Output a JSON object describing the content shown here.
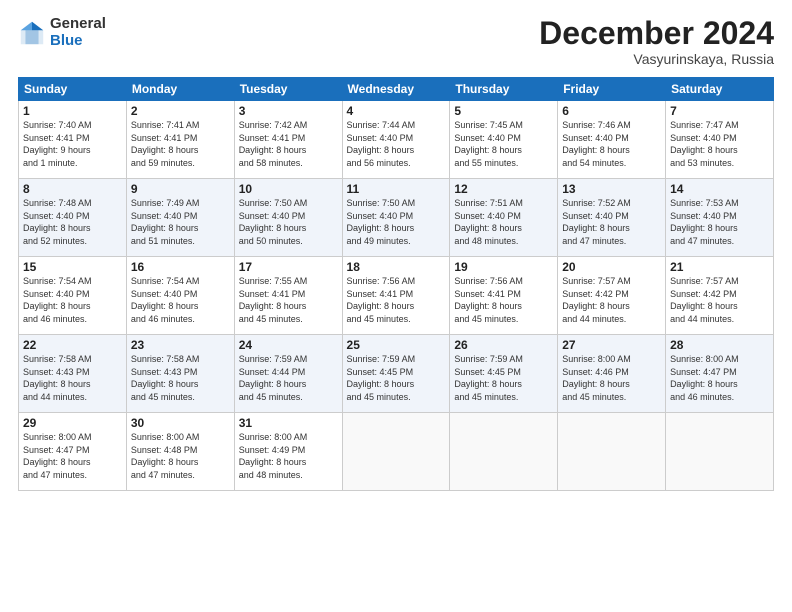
{
  "logo": {
    "general": "General",
    "blue": "Blue"
  },
  "header": {
    "month_title": "December 2024",
    "location": "Vasyurinskaya, Russia"
  },
  "weekdays": [
    "Sunday",
    "Monday",
    "Tuesday",
    "Wednesday",
    "Thursday",
    "Friday",
    "Saturday"
  ],
  "weeks": [
    [
      {
        "day": "1",
        "info": "Sunrise: 7:40 AM\nSunset: 4:41 PM\nDaylight: 9 hours\nand 1 minute."
      },
      {
        "day": "2",
        "info": "Sunrise: 7:41 AM\nSunset: 4:41 PM\nDaylight: 8 hours\nand 59 minutes."
      },
      {
        "day": "3",
        "info": "Sunrise: 7:42 AM\nSunset: 4:41 PM\nDaylight: 8 hours\nand 58 minutes."
      },
      {
        "day": "4",
        "info": "Sunrise: 7:44 AM\nSunset: 4:40 PM\nDaylight: 8 hours\nand 56 minutes."
      },
      {
        "day": "5",
        "info": "Sunrise: 7:45 AM\nSunset: 4:40 PM\nDaylight: 8 hours\nand 55 minutes."
      },
      {
        "day": "6",
        "info": "Sunrise: 7:46 AM\nSunset: 4:40 PM\nDaylight: 8 hours\nand 54 minutes."
      },
      {
        "day": "7",
        "info": "Sunrise: 7:47 AM\nSunset: 4:40 PM\nDaylight: 8 hours\nand 53 minutes."
      }
    ],
    [
      {
        "day": "8",
        "info": "Sunrise: 7:48 AM\nSunset: 4:40 PM\nDaylight: 8 hours\nand 52 minutes."
      },
      {
        "day": "9",
        "info": "Sunrise: 7:49 AM\nSunset: 4:40 PM\nDaylight: 8 hours\nand 51 minutes."
      },
      {
        "day": "10",
        "info": "Sunrise: 7:50 AM\nSunset: 4:40 PM\nDaylight: 8 hours\nand 50 minutes."
      },
      {
        "day": "11",
        "info": "Sunrise: 7:50 AM\nSunset: 4:40 PM\nDaylight: 8 hours\nand 49 minutes."
      },
      {
        "day": "12",
        "info": "Sunrise: 7:51 AM\nSunset: 4:40 PM\nDaylight: 8 hours\nand 48 minutes."
      },
      {
        "day": "13",
        "info": "Sunrise: 7:52 AM\nSunset: 4:40 PM\nDaylight: 8 hours\nand 47 minutes."
      },
      {
        "day": "14",
        "info": "Sunrise: 7:53 AM\nSunset: 4:40 PM\nDaylight: 8 hours\nand 47 minutes."
      }
    ],
    [
      {
        "day": "15",
        "info": "Sunrise: 7:54 AM\nSunset: 4:40 PM\nDaylight: 8 hours\nand 46 minutes."
      },
      {
        "day": "16",
        "info": "Sunrise: 7:54 AM\nSunset: 4:40 PM\nDaylight: 8 hours\nand 46 minutes."
      },
      {
        "day": "17",
        "info": "Sunrise: 7:55 AM\nSunset: 4:41 PM\nDaylight: 8 hours\nand 45 minutes."
      },
      {
        "day": "18",
        "info": "Sunrise: 7:56 AM\nSunset: 4:41 PM\nDaylight: 8 hours\nand 45 minutes."
      },
      {
        "day": "19",
        "info": "Sunrise: 7:56 AM\nSunset: 4:41 PM\nDaylight: 8 hours\nand 45 minutes."
      },
      {
        "day": "20",
        "info": "Sunrise: 7:57 AM\nSunset: 4:42 PM\nDaylight: 8 hours\nand 44 minutes."
      },
      {
        "day": "21",
        "info": "Sunrise: 7:57 AM\nSunset: 4:42 PM\nDaylight: 8 hours\nand 44 minutes."
      }
    ],
    [
      {
        "day": "22",
        "info": "Sunrise: 7:58 AM\nSunset: 4:43 PM\nDaylight: 8 hours\nand 44 minutes."
      },
      {
        "day": "23",
        "info": "Sunrise: 7:58 AM\nSunset: 4:43 PM\nDaylight: 8 hours\nand 45 minutes."
      },
      {
        "day": "24",
        "info": "Sunrise: 7:59 AM\nSunset: 4:44 PM\nDaylight: 8 hours\nand 45 minutes."
      },
      {
        "day": "25",
        "info": "Sunrise: 7:59 AM\nSunset: 4:45 PM\nDaylight: 8 hours\nand 45 minutes."
      },
      {
        "day": "26",
        "info": "Sunrise: 7:59 AM\nSunset: 4:45 PM\nDaylight: 8 hours\nand 45 minutes."
      },
      {
        "day": "27",
        "info": "Sunrise: 8:00 AM\nSunset: 4:46 PM\nDaylight: 8 hours\nand 45 minutes."
      },
      {
        "day": "28",
        "info": "Sunrise: 8:00 AM\nSunset: 4:47 PM\nDaylight: 8 hours\nand 46 minutes."
      }
    ],
    [
      {
        "day": "29",
        "info": "Sunrise: 8:00 AM\nSunset: 4:47 PM\nDaylight: 8 hours\nand 47 minutes."
      },
      {
        "day": "30",
        "info": "Sunrise: 8:00 AM\nSunset: 4:48 PM\nDaylight: 8 hours\nand 47 minutes."
      },
      {
        "day": "31",
        "info": "Sunrise: 8:00 AM\nSunset: 4:49 PM\nDaylight: 8 hours\nand 48 minutes."
      },
      {
        "day": "",
        "info": ""
      },
      {
        "day": "",
        "info": ""
      },
      {
        "day": "",
        "info": ""
      },
      {
        "day": "",
        "info": ""
      }
    ]
  ]
}
